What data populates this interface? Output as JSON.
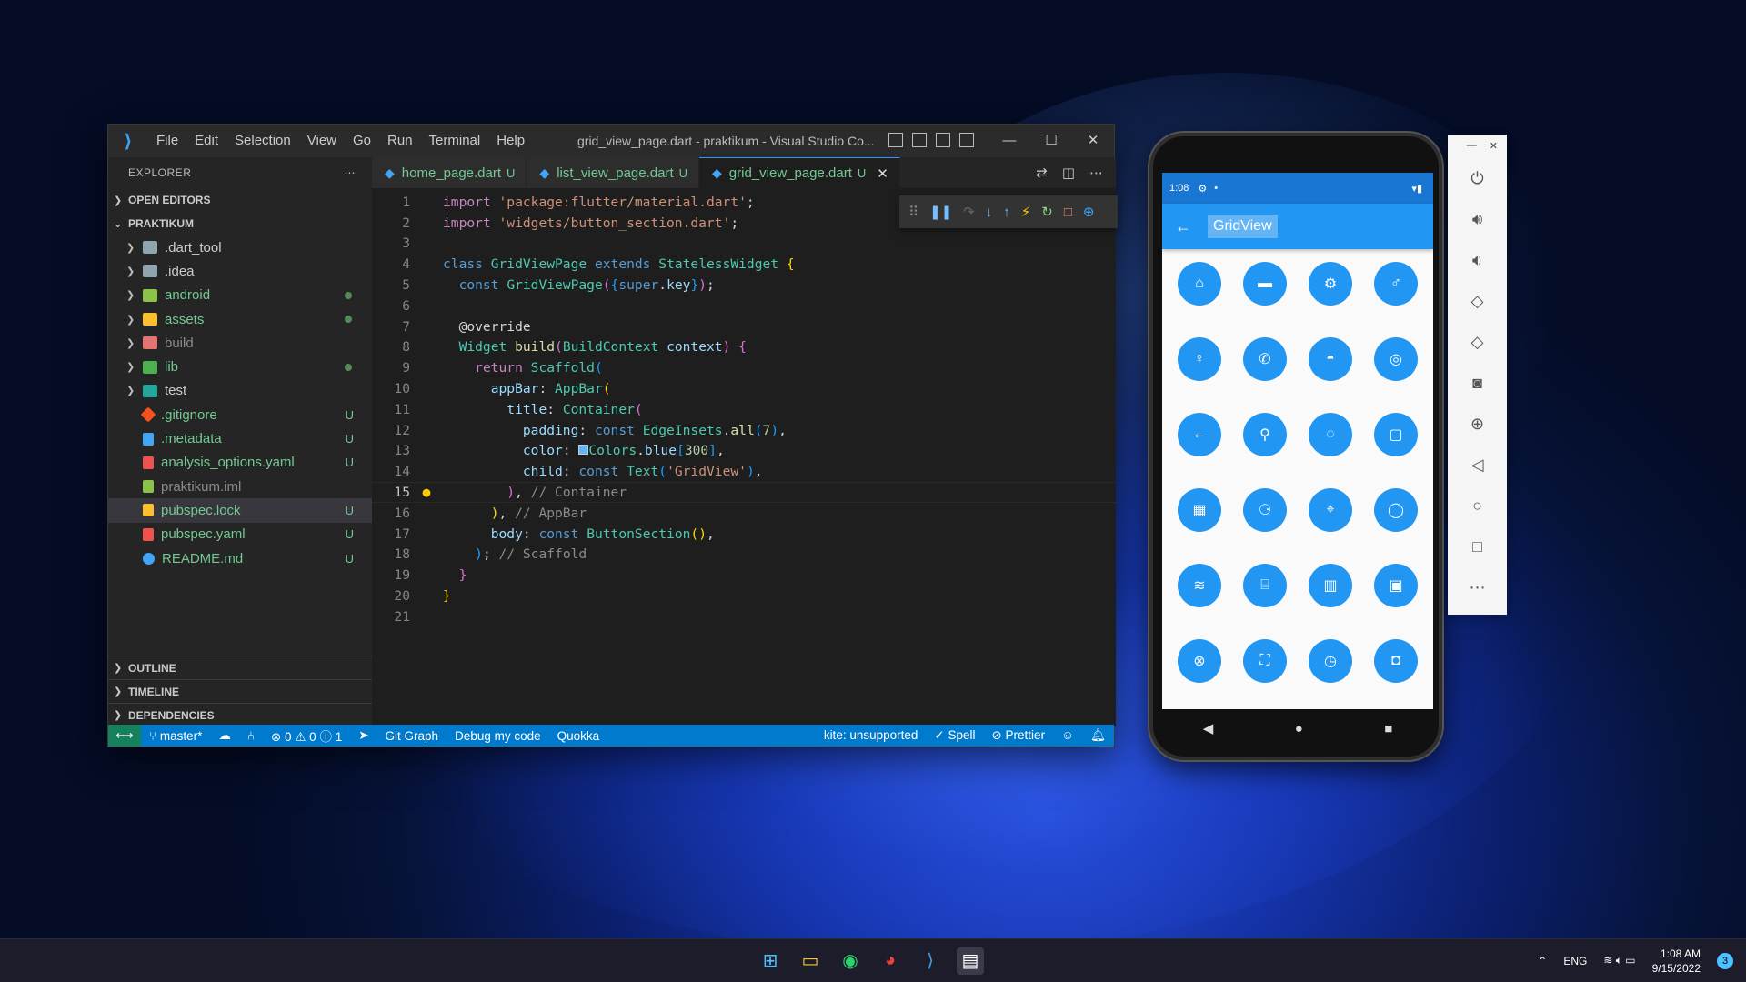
{
  "vscode": {
    "menu": [
      "File",
      "Edit",
      "Selection",
      "View",
      "Go",
      "Run",
      "Terminal",
      "Help"
    ],
    "window_title": "grid_view_page.dart - praktikum - Visual Studio Co...",
    "sidebar": {
      "header": "EXPLORER",
      "open_editors": "OPEN EDITORS",
      "project": "PRAKTIKUM",
      "items": [
        {
          "label": ".dart_tool",
          "type": "folder",
          "color": "#90a4ae"
        },
        {
          "label": ".idea",
          "type": "folder",
          "color": "#90a4ae"
        },
        {
          "label": "android",
          "type": "folder",
          "color": "#8bc34a",
          "dot": true
        },
        {
          "label": "assets",
          "type": "folder",
          "color": "#fbc02d",
          "dot": true
        },
        {
          "label": "build",
          "type": "folder",
          "color": "#e57373"
        },
        {
          "label": "lib",
          "type": "folder",
          "color": "#4caf50",
          "dot": true
        },
        {
          "label": "test",
          "type": "folder",
          "color": "#26a69a"
        },
        {
          "label": ".gitignore",
          "badge": "U",
          "color": "#f4511e"
        },
        {
          "label": ".metadata",
          "badge": "U",
          "color": "#42a5f5"
        },
        {
          "label": "analysis_options.yaml",
          "badge": "U",
          "color": "#ef5350"
        },
        {
          "label": "praktikum.iml",
          "color": "#8bc34a"
        },
        {
          "label": "pubspec.lock",
          "badge": "U",
          "color": "#fbc02d"
        },
        {
          "label": "pubspec.yaml",
          "badge": "U",
          "color": "#ef5350"
        },
        {
          "label": "README.md",
          "badge": "U",
          "color": "#42a5f5"
        }
      ],
      "outline": "OUTLINE",
      "timeline": "TIMELINE",
      "dependencies": "DEPENDENCIES"
    },
    "tabs": [
      {
        "label": "home_page.dart",
        "badge": "U"
      },
      {
        "label": "list_view_page.dart",
        "badge": "U"
      },
      {
        "label": "grid_view_page.dart",
        "badge": "U"
      }
    ],
    "line_numbers": [
      "1",
      "2",
      "3",
      "4",
      "5",
      "6",
      "7",
      "8",
      "9",
      "10",
      "11",
      "12",
      "13",
      "14",
      "15",
      "16",
      "17",
      "18",
      "19",
      "20",
      "21"
    ],
    "status": {
      "branch": "master*",
      "problems": "0",
      "warnings": "0",
      "info": "1",
      "git_graph": "Git Graph",
      "debug": "Debug my code",
      "quokka": "Quokka",
      "kite": "kite: unsupported",
      "spell": "Spell",
      "prettier": "Prettier"
    }
  },
  "phone": {
    "time": "1:08",
    "appbar_title": "GridView",
    "buttons": [
      "home-icon",
      "card-icon",
      "settings-icon",
      "male-icon",
      "female-icon",
      "phone-icon",
      "android-icon",
      "fingerprint-icon",
      "back-icon",
      "search-icon",
      "loading-icon",
      "tablet-icon",
      "calculator-icon",
      "bike-icon",
      "map-icon",
      "whatsapp-icon",
      "wifi-icon",
      "inbox-icon",
      "building-icon",
      "ticket-icon",
      "cancel-icon",
      "scan-icon",
      "alarm-icon",
      "box-icon"
    ]
  },
  "taskbar": {
    "lang": "ENG",
    "time": "1:08 AM",
    "date": "9/15/2022",
    "notifications": "3"
  }
}
